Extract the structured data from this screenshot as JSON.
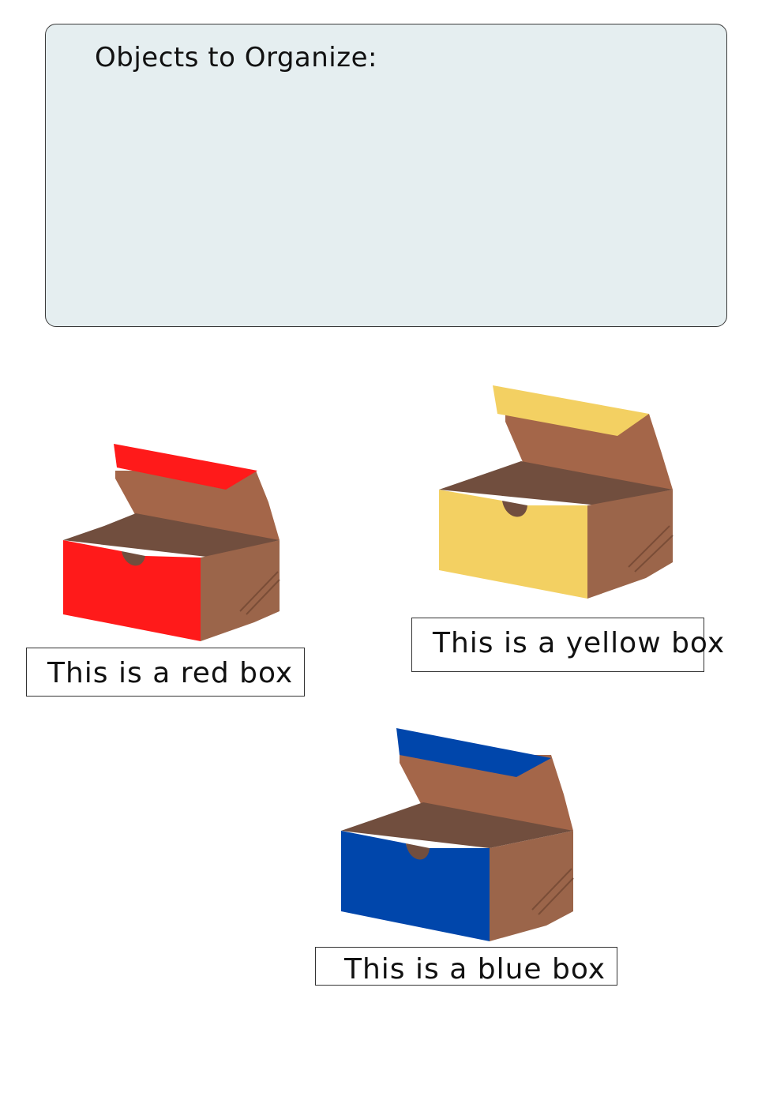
{
  "organizer": {
    "title": "Objects to Organize:"
  },
  "boxes": [
    {
      "id": "red",
      "label": "This is a red box",
      "color": "#ff1a1a"
    },
    {
      "id": "yellow",
      "label": "This is a yellow box",
      "color": "#f3d062"
    },
    {
      "id": "blue",
      "label": "This is a blue box",
      "color": "#0046ab"
    }
  ],
  "palette": {
    "cardboard_side": "#9b654a",
    "cardboard_inside": "#714e3e",
    "lid_inside": "#a46649",
    "panel_background": "#e5eef0"
  }
}
